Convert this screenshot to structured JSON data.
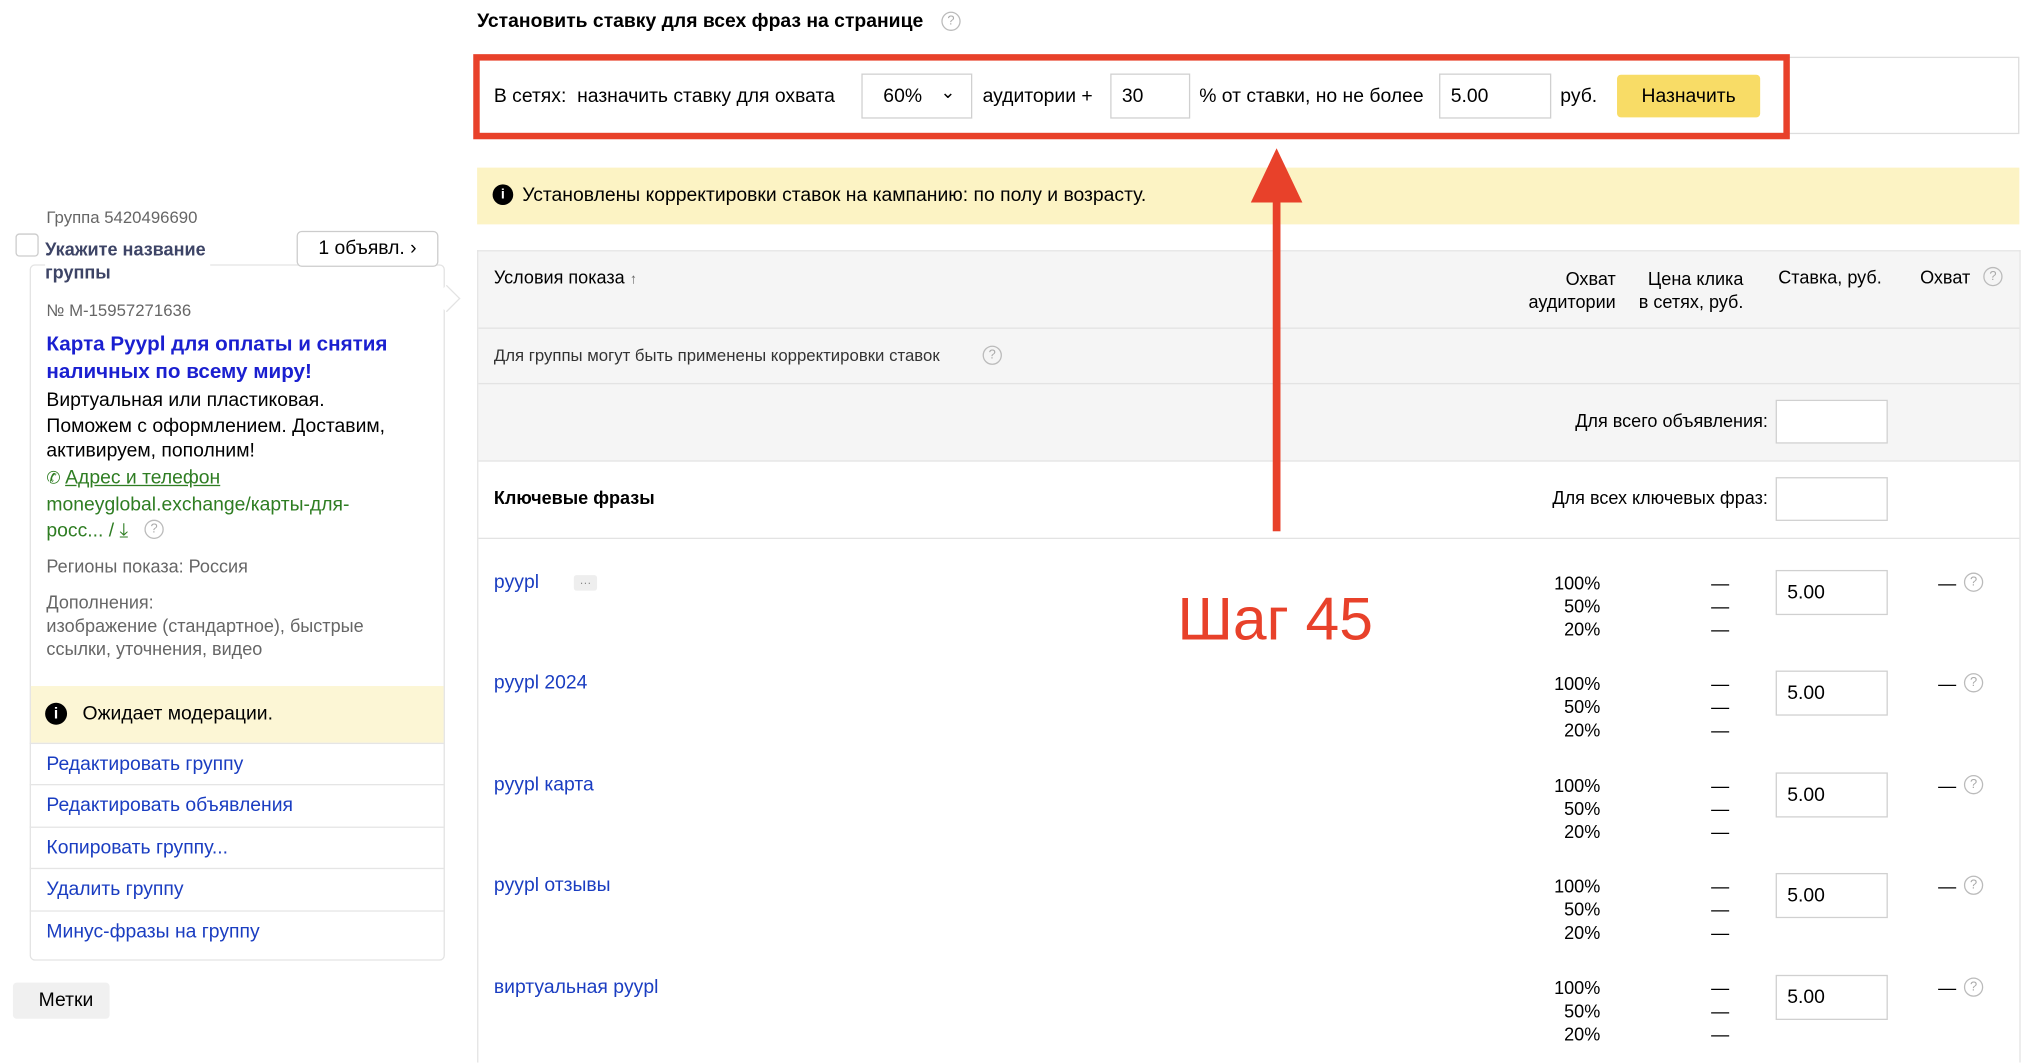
{
  "bulk": {
    "title": "Установить ставку для всех фраз на странице",
    "networks_label": "В сетях:",
    "assign_label": "назначить ставку для охвата",
    "coverage_value": "60%",
    "audience_label": "аудитории +",
    "percent_value": "30",
    "percent_label": "% от ставки, но не более",
    "max_value": "5.00",
    "currency": "руб.",
    "assign_button": "Назначить"
  },
  "notice": "Установлены корректировки ставок на кампанию: по полу и возрасту.",
  "table": {
    "col_conditions": "Условия показа",
    "sort_arrow": "↑",
    "col_reach_1": "Охват",
    "col_reach_2": "аудитории",
    "col_price_1": "Цена клика",
    "col_price_2": "в сетях, руб.",
    "col_bid": "Ставка, руб.",
    "col_coverage": "Охват",
    "adjustments_note": "Для группы могут быть применены корректировки ставок",
    "whole_ad_label": "Для всего объявления:",
    "whole_ad_value": "",
    "keywords_title": "Ключевые фразы",
    "all_keywords_label": "Для всех ключевых фраз:",
    "all_keywords_value": "",
    "more_badge": "···",
    "rows": [
      {
        "phrase": "pyypl",
        "reach": [
          "100%",
          "50%",
          "20%"
        ],
        "price": [
          "—",
          "—",
          "—"
        ],
        "bid": "5.00",
        "coverage": "—"
      },
      {
        "phrase": "pyypl 2024",
        "reach": [
          "100%",
          "50%",
          "20%"
        ],
        "price": [
          "—",
          "—",
          "—"
        ],
        "bid": "5.00",
        "coverage": "—"
      },
      {
        "phrase": "pyypl карта",
        "reach": [
          "100%",
          "50%",
          "20%"
        ],
        "price": [
          "—",
          "—",
          "—"
        ],
        "bid": "5.00",
        "coverage": "—"
      },
      {
        "phrase": "pyypl отзывы",
        "reach": [
          "100%",
          "50%",
          "20%"
        ],
        "price": [
          "—",
          "—",
          "—"
        ],
        "bid": "5.00",
        "coverage": "—"
      },
      {
        "phrase": "виртуальная pyypl",
        "reach": [
          "100%",
          "50%",
          "20%"
        ],
        "price": [
          "—",
          "—",
          "—"
        ],
        "bid": "5.00",
        "coverage": "—"
      }
    ]
  },
  "annotation": {
    "step": "Шаг 45",
    "color": "#e8412a"
  },
  "group": {
    "id_label": "Группа 5420496690",
    "name_placeholder_1": "Укажите название",
    "name_placeholder_2": "группы",
    "ads_button": "1 объявл. ›",
    "ad_number": "№ M-15957271636",
    "ad_title_1": "Карта Pyypl для оплаты и снятия",
    "ad_title_2": "наличных по всему миру!",
    "ad_text_1": "Виртуальная или пластиковая.",
    "ad_text_2": "Поможем с оформлением. Доставим,",
    "ad_text_3": "активируем, пополним!",
    "contact_link": "Адрес и телефон",
    "url_1": "moneyglobal.exchange/карты-для-",
    "url_2": "росс... /",
    "regions": "Регионы показа: Россия",
    "extras_label": "Дополнения:",
    "extras_1": "изображение (стандартное), быстрые",
    "extras_2": "ссылки, уточнения, видео",
    "status": "Ожидает модерации.",
    "actions": [
      "Редактировать группу",
      "Редактировать объявления",
      "Копировать группу...",
      "Удалить группу",
      "Минус-фразы на группу"
    ],
    "tags_label": "Метки"
  }
}
